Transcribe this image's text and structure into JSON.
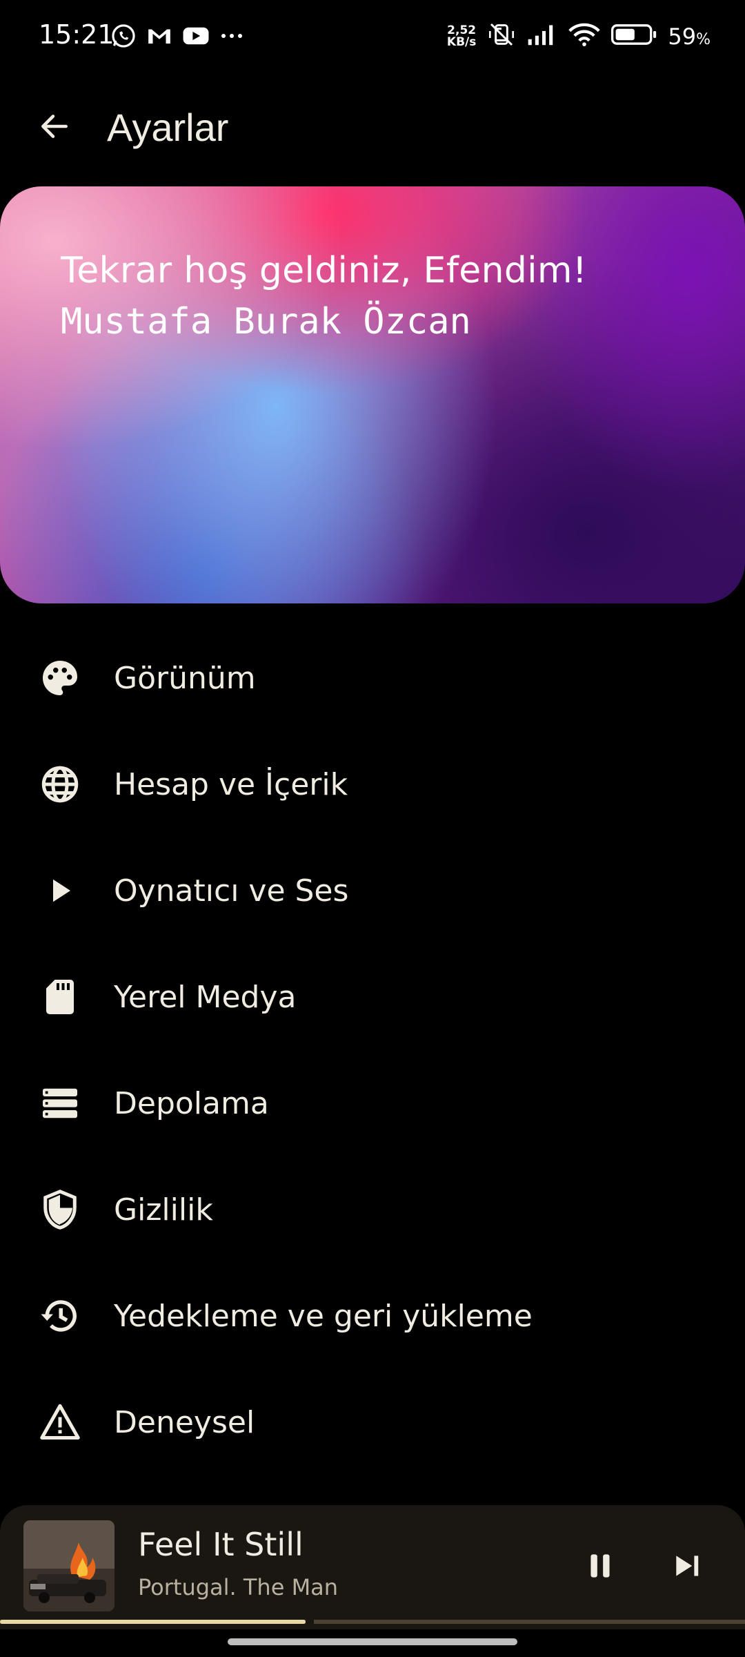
{
  "status_bar": {
    "time": "15:21",
    "notification_icons": [
      "whatsapp-icon",
      "gmail-icon",
      "youtube-icon",
      "more-dots-icon"
    ],
    "net_speed_value": "2,52",
    "net_speed_unit": "KB/s",
    "battery_percent": "59",
    "battery_unit": "%",
    "battery_level": 0.59
  },
  "app_bar": {
    "title": "Ayarlar"
  },
  "hero": {
    "greeting": "Tekrar hoş geldiniz, Efendim!",
    "name": "Mustafa Burak Özcan"
  },
  "settings": [
    {
      "label": "Görünüm",
      "icon": "palette-icon"
    },
    {
      "label": "Hesap ve İçerik",
      "icon": "globe-icon"
    },
    {
      "label": "Oynatıcı ve Ses",
      "icon": "play-icon"
    },
    {
      "label": "Yerel Medya",
      "icon": "sd-card-icon"
    },
    {
      "label": "Depolama",
      "icon": "storage-icon"
    },
    {
      "label": "Gizlilik",
      "icon": "shield-icon"
    },
    {
      "label": "Yedekleme ve geri yükleme",
      "icon": "history-icon"
    },
    {
      "label": "Deneysel",
      "icon": "warning-icon"
    }
  ],
  "player": {
    "title": "Feel It Still",
    "artist": "Portugal. The Man",
    "progress": 0.41,
    "colors": {
      "background": "#1a1712",
      "progress_fill": "#e8d8a8",
      "progress_track": "#4a4232"
    }
  }
}
